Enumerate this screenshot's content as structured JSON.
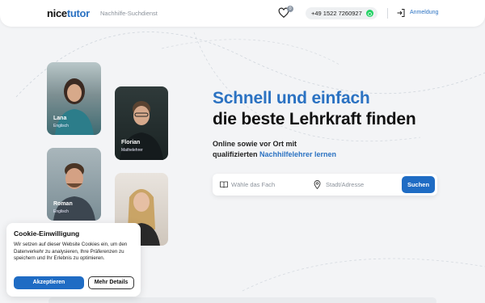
{
  "header": {
    "logo_part1": "nice",
    "logo_part2": "tutor",
    "tagline": "Nachhilfe-Suchdienst",
    "favorites_count": "0",
    "phone": "+49 1522 7260927",
    "login_label": "Anmeldung"
  },
  "tutors": [
    {
      "name": "Lana",
      "subject": "Englisch"
    },
    {
      "name": "Florian",
      "subject": "Mathelehrer"
    },
    {
      "name": "Roman",
      "subject": "Englisch"
    },
    {
      "name": "",
      "subject": ""
    }
  ],
  "hero": {
    "title_line1": "Schnell und einfach",
    "title_line2": "die beste Lehrkraft finden",
    "sub_line1": "Online sowie vor Ort mit",
    "sub_line2_prefix": "qualifizierten ",
    "sub_line2_link": "Nachhilfelehrer lernen"
  },
  "search": {
    "subject_placeholder": "Wähle das Fach",
    "city_placeholder": "Stadt/Adresse",
    "button_label": "Suchen"
  },
  "cookie": {
    "title": "Cookie-Einwilligung",
    "text": "Wir setzen auf dieser Website Cookies ein, um den Datenverkehr zu analysieren, Ihre Präferenzen zu speichern und Ihr Erlebnis zu optimieren.",
    "accept_label": "Akzeptieren",
    "more_label": "Mehr Details"
  },
  "colors": {
    "brand_blue": "#2b72c2",
    "button_blue": "#1f6cc4",
    "whatsapp": "#25d366"
  },
  "icons": [
    "heart-icon",
    "whatsapp-icon",
    "login-icon",
    "book-icon",
    "location-pin-icon"
  ]
}
